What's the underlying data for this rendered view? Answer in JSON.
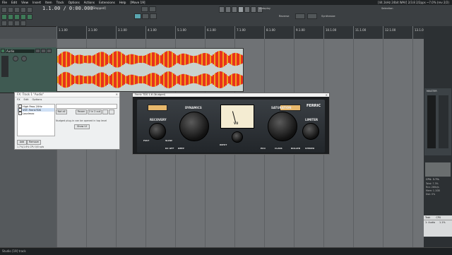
{
  "menubar": {
    "items": [
      "File",
      "Edit",
      "View",
      "Insert",
      "Item",
      "Track",
      "Options",
      "Actions",
      "Extensions",
      "Help",
      "[Move 19]"
    ],
    "window_title": "[44.1kHz 24bit WAV] 2/3.8 2/2pps ~7.0% (rev 2/2)"
  },
  "toolbar": {
    "timecode": "1.1.00 / 0:00.000",
    "status": "[Stopped]",
    "autoplay_label": "Autoplay",
    "reverse_label": "Reverse",
    "synthesize_label": "Synthesize",
    "selection_label": "Selection"
  },
  "ruler": {
    "ticks": [
      "1.1.00",
      "2.1.00",
      "3.1.00",
      "4.1.00",
      "5.1.00",
      "6.1.00",
      "7.1.00",
      "8.1.00",
      "9.1.00",
      "10.1.00",
      "11.1.00",
      "12.1.00",
      "13.1.00"
    ]
  },
  "track": {
    "name": "Audio",
    "number": "1"
  },
  "fx_window": {
    "title": "FX: Track 1 \"Audio\"",
    "menu": [
      "FX",
      "Edit",
      "Options"
    ],
    "fx_list": [
      "High Pass 20Hz",
      "VST: FerricTDS",
      "Loudmax"
    ],
    "param_btn": "Param",
    "io_btn": "2 in 2 out",
    "no_ui_label": "Not all",
    "note": "Nudged plug-in can be opened in top level",
    "show_ui_btn": "Show UI",
    "add_btn": "Add",
    "remove_btn": "Remove",
    "cpu_label": "1.7%/1.6% CPU 0/0 spls"
  },
  "plugin": {
    "title": "Ferric TDS 1.6 (Nudged)",
    "brand": "FERRIC",
    "dynamics": "DYNAMICS",
    "recovery": "RECOVERY",
    "saturation": "SATURATION",
    "limiter": "LIMITER",
    "vu": "VU",
    "fast": "FAST",
    "slow": "SLOW",
    "input": "INPUT",
    "dc_off": "DC OFF",
    "deep": "DEEP",
    "eco": "ECO",
    "class": "CLASS",
    "roller": "ROLLER",
    "stereo": "STEREO"
  },
  "right_panel": {
    "master_label": "MASTER",
    "cpu_label": "CPU: 3.7%",
    "info": [
      "Total: 7.3%",
      "Rcv: 26Hz/s",
      "Mem: 1.1GB",
      "Dsk: 0%"
    ],
    "task_header": [
      "Task",
      "CPU"
    ],
    "task_row": [
      "1: Audio",
      "1.1%"
    ]
  },
  "bottom": {
    "status": "Studio [19] track"
  },
  "colors": {
    "accent": "#3f7a58",
    "waveform_hot": "#e8311c",
    "waveform_warm": "#f0a21c",
    "arrange_bg": "#6f7275"
  }
}
